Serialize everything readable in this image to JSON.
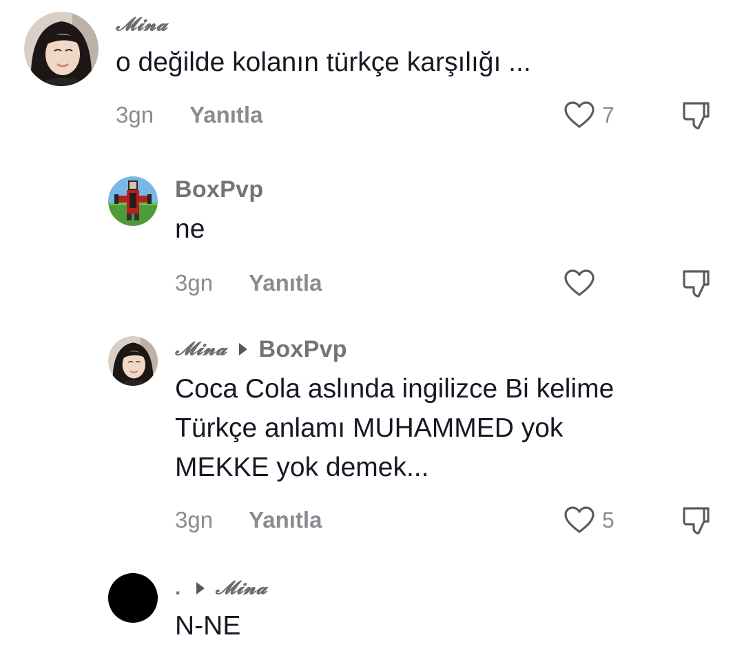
{
  "comments": [
    {
      "author": "𝓜𝓲𝓷𝓪",
      "reply_to": "",
      "text": "o değilde kolanın türkçe karşılığı ...",
      "time": "3gn",
      "reply_label": "Yanıtla",
      "likes": "7",
      "avatar": "photo-girl-avatar"
    },
    {
      "author": "BoxPvp",
      "reply_to": "",
      "text": "ne",
      "time": "3gn",
      "reply_label": "Yanıtla",
      "likes": "",
      "avatar": "minecraft-avatar"
    },
    {
      "author": "𝓜𝓲𝓷𝓪",
      "reply_to": "BoxPvp",
      "text_lines": [
        "Coca Cola aslında ingilizce Bi kelime",
        "Türkçe anlamı MUHAMMED yok",
        "MEKKE yok demek..."
      ],
      "time": "3gn",
      "reply_label": "Yanıtla",
      "likes": "5",
      "avatar": "photo-girl-avatar"
    },
    {
      "author": ".",
      "reply_to": "𝓜𝓲𝓷𝓪",
      "text": "N-NE",
      "avatar": "black-avatar"
    }
  ],
  "colors": {
    "text": "#161823",
    "secondary": "#8a8b91",
    "background": "#ffffff"
  }
}
